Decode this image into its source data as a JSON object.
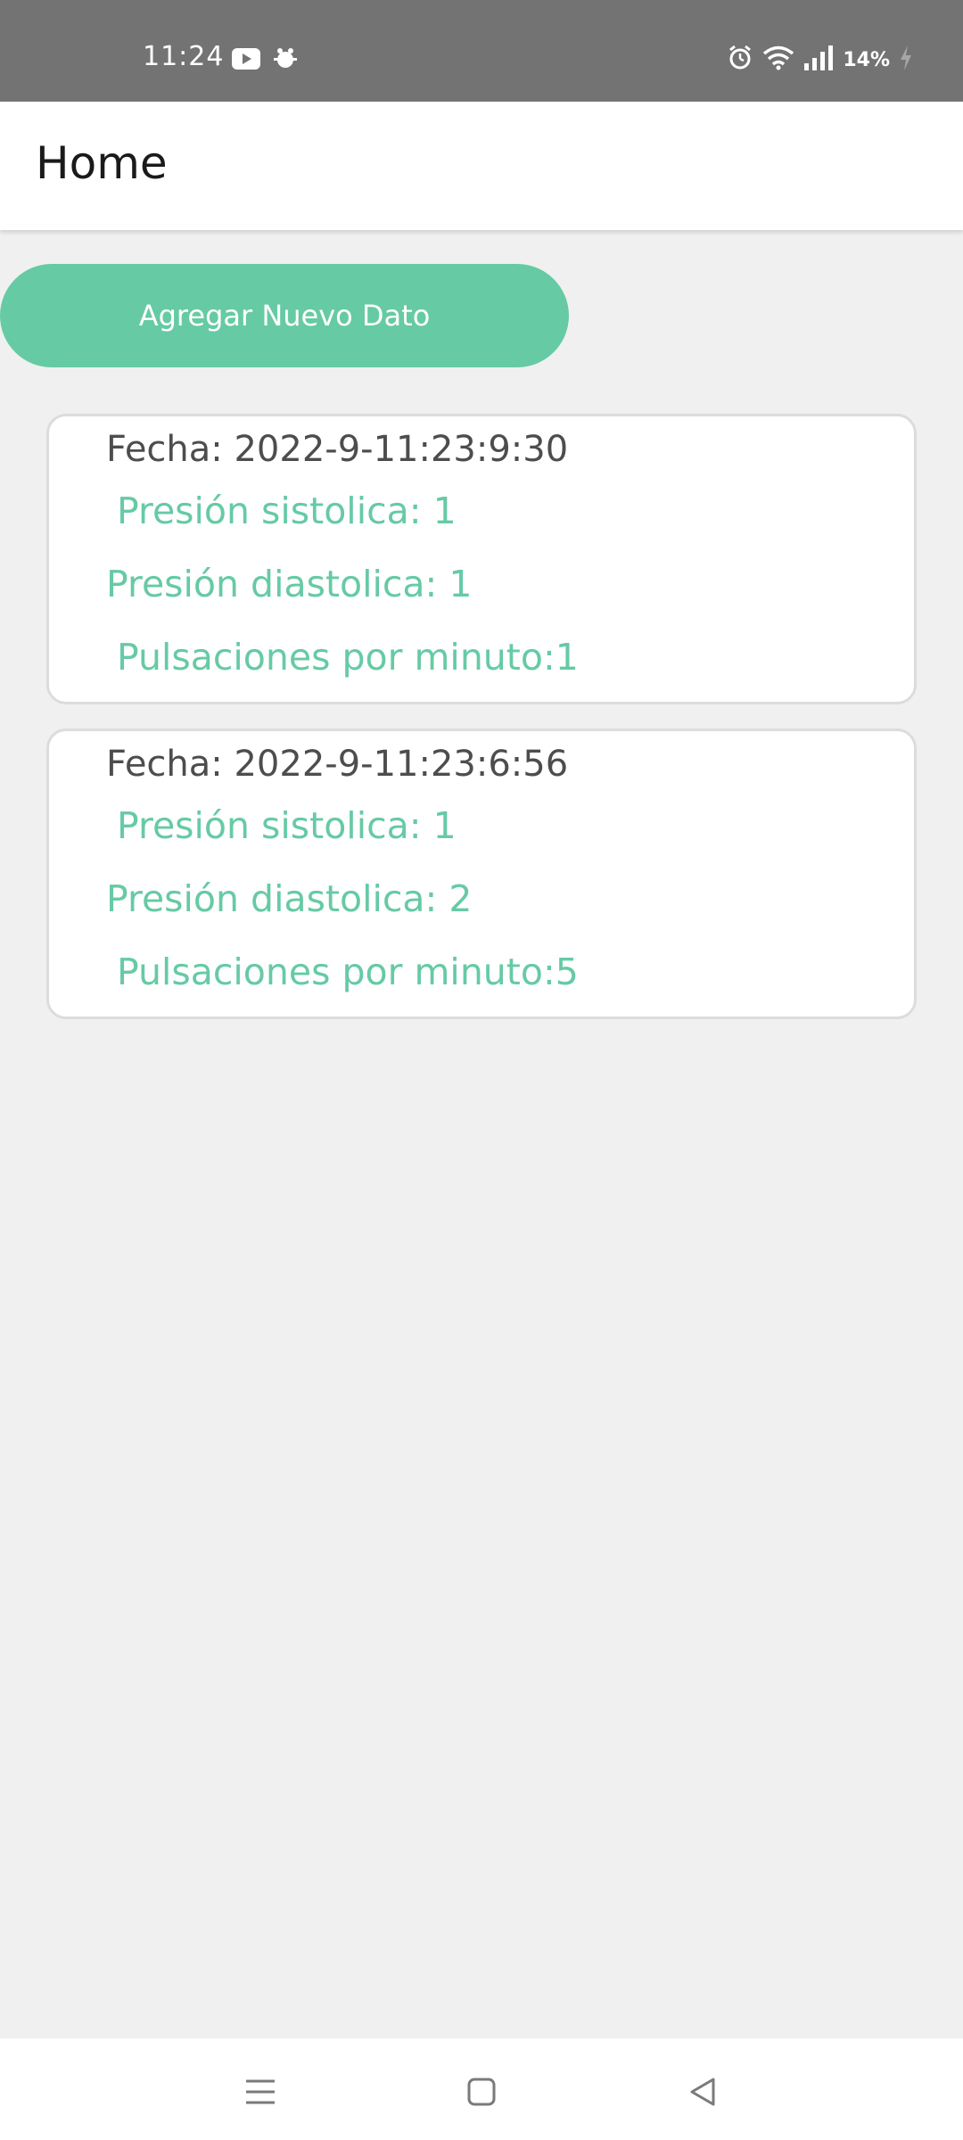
{
  "status_bar": {
    "time": "11:24",
    "battery": "14%",
    "icons": [
      "youtube-icon",
      "bug-icon",
      "alarm-icon",
      "wifi-icon",
      "signal-icon",
      "charging-icon"
    ]
  },
  "app_bar": {
    "title": "Home"
  },
  "actions": {
    "add_label": "Agregar Nuevo Dato"
  },
  "colors": {
    "accent": "#66caa5",
    "status_bar": "#737373",
    "background": "#f0f0f0"
  },
  "records": [
    {
      "date": "Fecha: 2022-9-11:23:9:30",
      "systolic": "Presión sistolica: 1",
      "diastolic": "Presión diastolica: 1",
      "pulse": "Pulsaciones por minuto:1"
    },
    {
      "date": "Fecha: 2022-9-11:23:6:56",
      "systolic": "Presión sistolica: 1",
      "diastolic": "Presión diastolica: 2",
      "pulse": "Pulsaciones por minuto:5"
    }
  ],
  "nav_bar": {
    "icons": [
      "menu-icon",
      "home-icon",
      "back-icon"
    ]
  }
}
